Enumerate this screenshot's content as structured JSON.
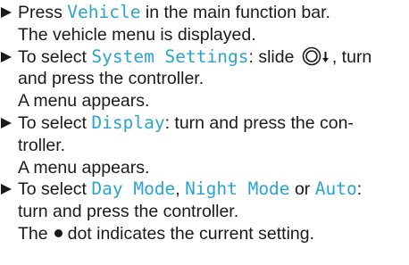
{
  "steps": [
    {
      "line1_keyword": "Vehicle",
      "line1_prefix": "Press ",
      "line1_suffix": " in the main function bar.",
      "line2": "The vehicle menu is displayed."
    },
    {
      "line1_prefix": "To select ",
      "line1_keyword": "System Settings",
      "line1_mid": ": slide ",
      "line1_suffix": ", turn",
      "line2": "and press the controller.",
      "line3": "A menu appears.",
      "controller_icon": "controller-knob-icon",
      "direction_icon": "arrow-down-icon"
    },
    {
      "line1_prefix": "To select ",
      "line1_keyword": "Display",
      "line1_suffix": ": turn and press the con-",
      "line2": "troller.",
      "line3": "A menu appears."
    },
    {
      "line1_prefix": "To select ",
      "kw1": "Day Mode",
      "sep1": ", ",
      "kw2": "Night Mode",
      "sep2": " or ",
      "kw3": "Auto",
      "line1_suffix": ":",
      "line2": "turn and press the controller.",
      "line3_prefix": "The",
      "line3_suffix": "dot indicates the current setting."
    }
  ],
  "colors": {
    "keyword": "#2aa5cf",
    "text": "#1a1a1a"
  }
}
